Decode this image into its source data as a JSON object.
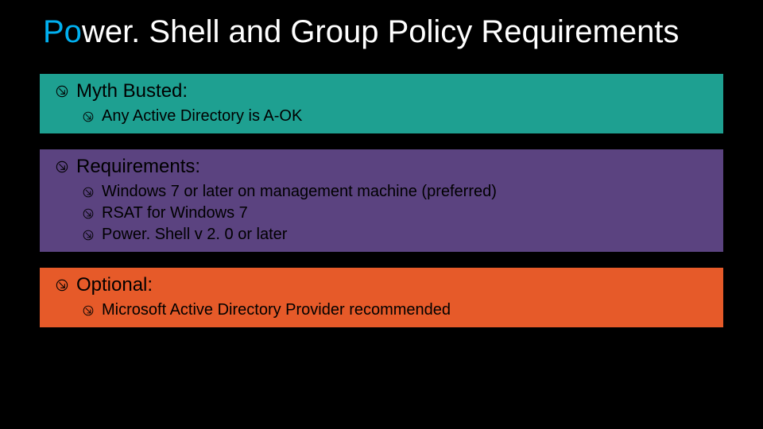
{
  "title": {
    "accent_prefix": "Po",
    "rest": "wer. Shell and Group Policy Requirements"
  },
  "sections": [
    {
      "id": "myth",
      "heading": "Myth Busted:",
      "items": [
        "Any Active Directory is A-OK"
      ]
    },
    {
      "id": "requirements",
      "heading": "Requirements:",
      "items": [
        "Windows 7 or later on management machine (preferred)",
        "RSAT for Windows 7",
        "Power. Shell v 2. 0 or later"
      ]
    },
    {
      "id": "optional",
      "heading": "Optional:",
      "items": [
        "Microsoft Active Directory Provider recommended"
      ]
    }
  ]
}
